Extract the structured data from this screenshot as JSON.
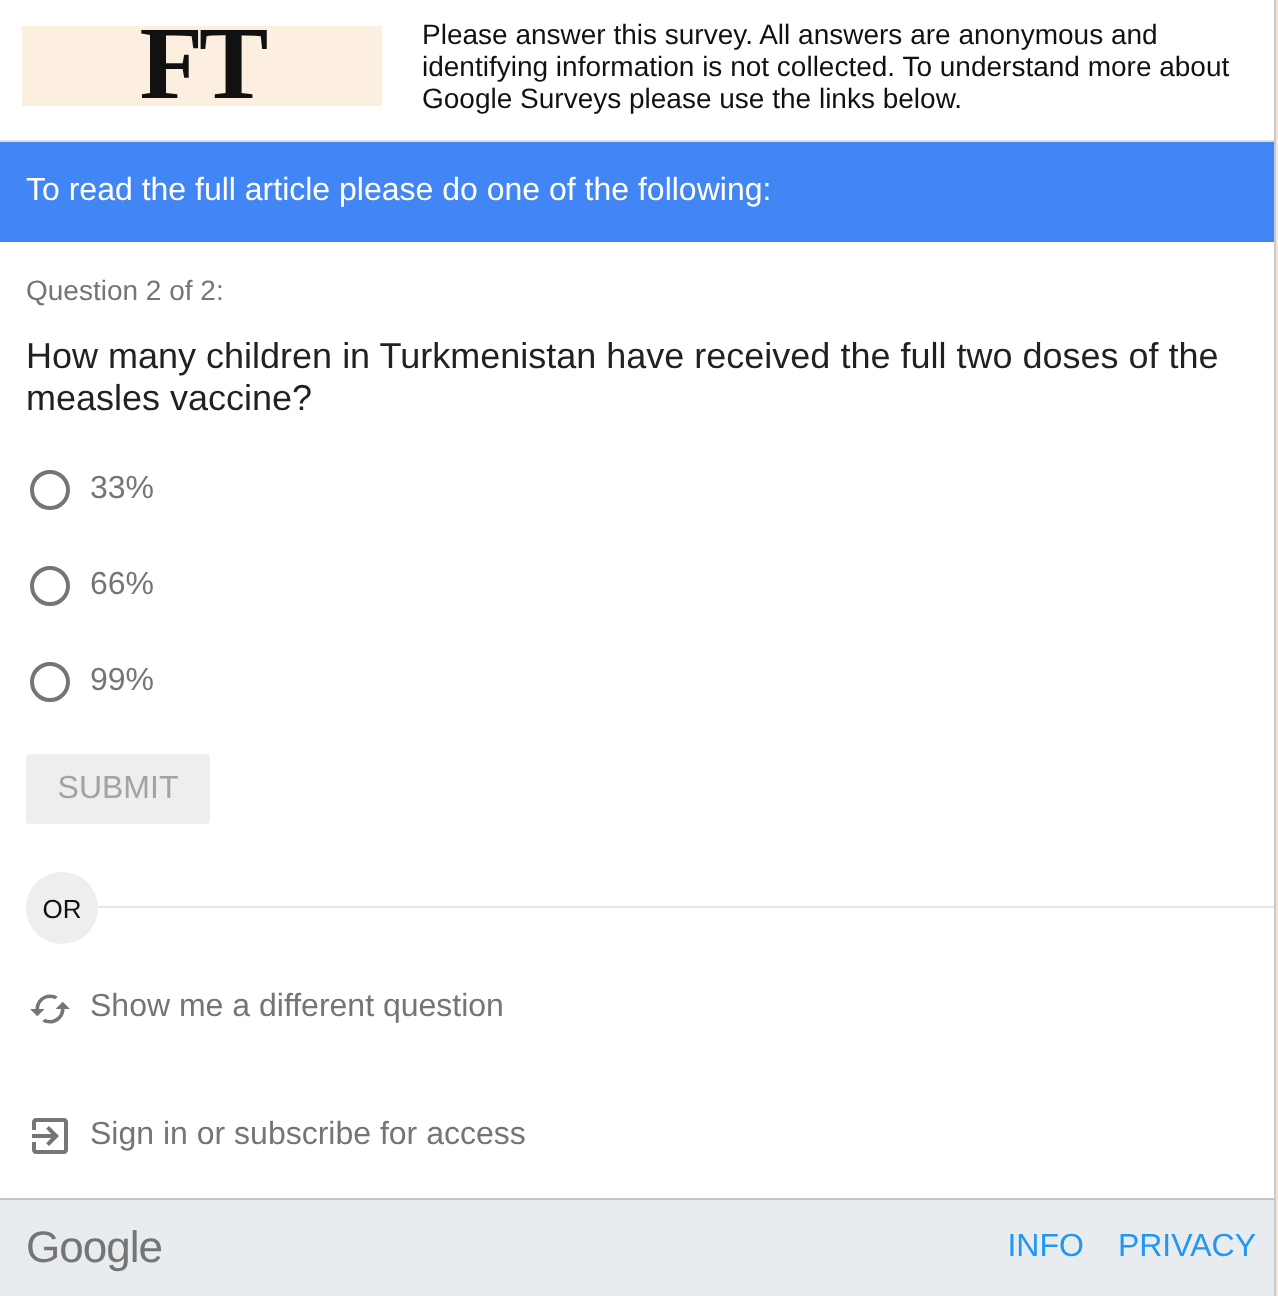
{
  "header": {
    "logo": "FT",
    "notice": "Please answer this survey. All answers are anonymous and identifying information is not collected. To understand more about Google Surveys please use the links below."
  },
  "banner": {
    "text": "To read the full article please do one of the following:"
  },
  "question": {
    "counter": "Question 2 of 2:",
    "text": "How many children in Turkmenistan have received the full two doses of the measles vaccine?",
    "options": [
      {
        "label": "33%",
        "selected": false
      },
      {
        "label": "66%",
        "selected": false
      },
      {
        "label": "99%",
        "selected": false
      }
    ]
  },
  "submit": {
    "label": "SUBMIT",
    "disabled": true
  },
  "separator": {
    "label": "OR"
  },
  "actions": [
    {
      "kind": "refresh",
      "label": "Show me a different question"
    },
    {
      "kind": "sign-in",
      "label": "Sign in or subscribe for access"
    }
  ],
  "footer": {
    "brand": "Google",
    "links": [
      "INFO",
      "PRIVACY"
    ]
  }
}
